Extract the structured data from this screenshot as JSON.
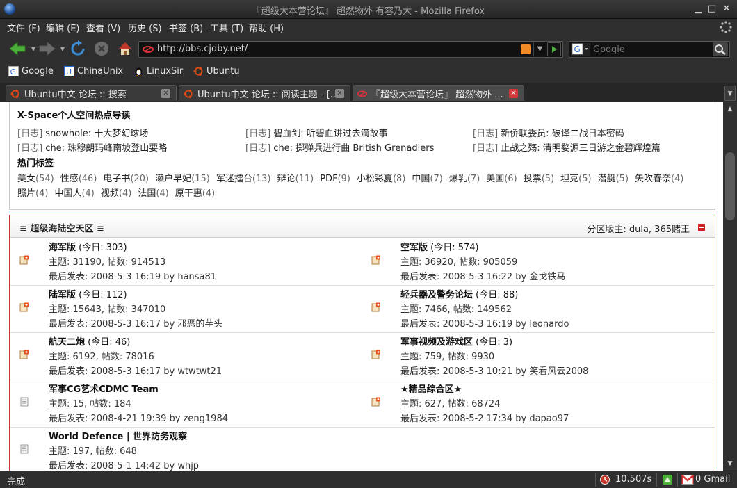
{
  "window": {
    "title": "『超级大本营论坛』 超然物外 有容乃大 - Mozilla Firefox"
  },
  "menu": {
    "items": [
      "文件 (F)",
      "编辑 (E)",
      "查看 (V)",
      "历史 (S)",
      "书签 (B)",
      "工具 (T)",
      "帮助 (H)"
    ]
  },
  "nav": {
    "url": "http://bbs.cjdby.net/",
    "search_placeholder": "Google"
  },
  "bookmarks": [
    "Google",
    "ChinaUnix",
    "LinuxSir",
    "Ubuntu"
  ],
  "tabs": [
    {
      "label": "Ubuntu中文 论坛 :: 搜索"
    },
    {
      "label": "Ubuntu中文 论坛 :: 阅读主题 - [..."
    },
    {
      "label": "『超级大本营论坛』 超然物外 ..."
    }
  ],
  "xspace": {
    "title": "X-Space个人空间热点导读",
    "items": [
      {
        "tag": "[日志]",
        "text": "snowhole: 十大梦幻球场"
      },
      {
        "tag": "[日志]",
        "text": "碧血剑: 听碧血讲过去滴故事"
      },
      {
        "tag": "[日志]",
        "text": "新侨联委员: 破译二战日本密码"
      },
      {
        "tag": "[日志]",
        "text": "che: 珠穆朗玛峰南坡登山要略"
      },
      {
        "tag": "[日志]",
        "text": "che: 掷弹兵进行曲 British Grenadiers"
      },
      {
        "tag": "[日志]",
        "text": "止战之殇: 清明婺源三日游之金碧辉煌篇"
      }
    ],
    "hot_title": "热门标签",
    "tags": [
      {
        "name": "美女",
        "count": "(54)"
      },
      {
        "name": "性感",
        "count": "(46)"
      },
      {
        "name": "电子书",
        "count": "(20)"
      },
      {
        "name": "濑户早妃",
        "count": "(15)"
      },
      {
        "name": "军迷擂台",
        "count": "(13)"
      },
      {
        "name": "辩论",
        "count": "(11)"
      },
      {
        "name": "PDF",
        "count": "(9)"
      },
      {
        "name": "小松彩夏",
        "count": "(8)"
      },
      {
        "name": "中国",
        "count": "(7)"
      },
      {
        "name": "爆乳",
        "count": "(7)"
      },
      {
        "name": "美国",
        "count": "(6)"
      },
      {
        "name": "投票",
        "count": "(5)"
      },
      {
        "name": "坦克",
        "count": "(5)"
      },
      {
        "name": "潜艇",
        "count": "(5)"
      },
      {
        "name": "矢吹春奈",
        "count": "(4)"
      },
      {
        "name": "照片",
        "count": "(4)"
      },
      {
        "name": "中国人",
        "count": "(4)"
      },
      {
        "name": "视频",
        "count": "(4)"
      },
      {
        "name": "法国",
        "count": "(4)"
      },
      {
        "name": "原干惠",
        "count": "(4)"
      }
    ]
  },
  "forum": {
    "title": "≡ 超级海陆空天区 ≡",
    "moderators": "分区版主: dula, 365赌王",
    "boards": [
      {
        "name": "海军版",
        "today": "(今日: 303)",
        "stats": "主题: 31190, 帖数: 914513",
        "last": "最后发表: 2008-5-3 16:19 by hansa81",
        "new": true
      },
      {
        "name": "空军版",
        "today": "(今日: 574)",
        "stats": "主题: 36920, 帖数: 905059",
        "last": "最后发表: 2008-5-3 16:22 by 金戈铁马",
        "new": true
      },
      {
        "name": "陆军版",
        "today": "(今日: 112)",
        "stats": "主题: 15643, 帖数: 347010",
        "last": "最后发表: 2008-5-3 16:17 by 邪恶的芋头",
        "new": true
      },
      {
        "name": "轻兵器及警务论坛",
        "today": "(今日: 88)",
        "stats": "主题: 7466, 帖数: 149562",
        "last": "最后发表: 2008-5-3 16:19 by leonardo",
        "new": true
      },
      {
        "name": "航天二炮",
        "today": "(今日: 46)",
        "stats": "主题: 6192, 帖数: 78016",
        "last": "最后发表: 2008-5-3 16:17 by wtwtwt21",
        "new": true
      },
      {
        "name": "军事视频及游戏区",
        "today": "(今日: 3)",
        "stats": "主题: 759, 帖数: 9930",
        "last": "最后发表: 2008-5-3 10:21 by 笑看风云2008",
        "new": true
      },
      {
        "name": "军事CG艺术CDMC Team",
        "today": "",
        "stats": "主题: 15, 帖数: 184",
        "last": "最后发表: 2008-4-21 19:39 by zeng1984",
        "new": false
      },
      {
        "name": "★精品综合区★",
        "today": "",
        "stats": "主题: 627, 帖数: 68724",
        "last": "最后发表: 2008-5-2 17:34 by dapao97",
        "new": true
      },
      {
        "name": "World Defence | 世界防务观察",
        "today": "",
        "stats": "主题: 197, 帖数: 648",
        "last": "最后发表: 2008-5-1 14:42 by whjp",
        "new": false
      }
    ]
  },
  "status": {
    "text": "完成",
    "timer": "10.507s",
    "gmail": "0 Gmail"
  }
}
